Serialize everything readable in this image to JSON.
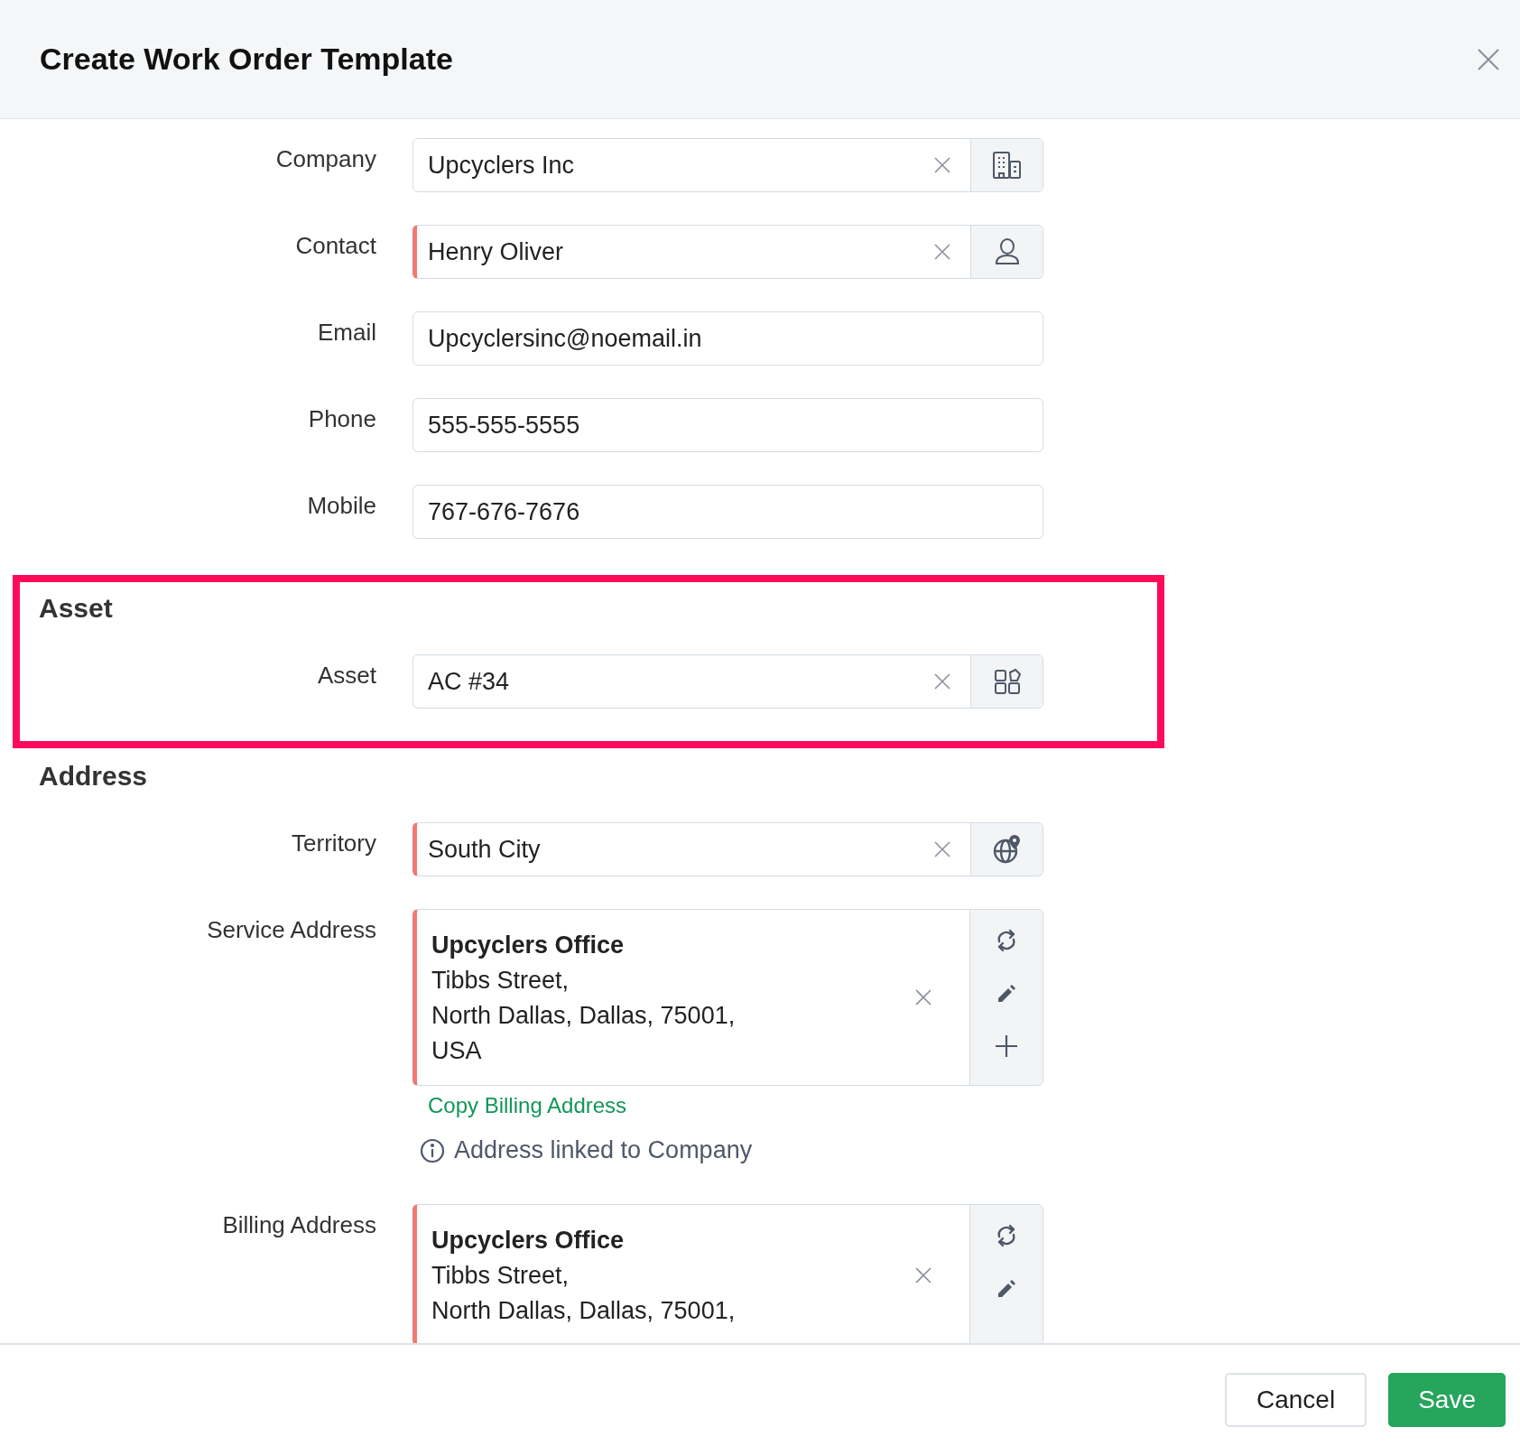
{
  "dialog": {
    "title": "Create Work Order Template"
  },
  "sections": [
    {
      "highlighted": false,
      "fields": [
        {
          "kind": "company",
          "label": "Company",
          "value": "Upcyclers Inc",
          "required": false
        },
        {
          "kind": "contact",
          "label": "Contact",
          "value": "Henry Oliver",
          "required": true
        },
        {
          "kind": "text",
          "label": "Email",
          "value": "Upcyclersinc@noemail.in",
          "required": false
        },
        {
          "kind": "text",
          "label": "Phone",
          "value": "555-555-5555",
          "required": false
        },
        {
          "kind": "text",
          "label": "Mobile",
          "value": "767-676-7676",
          "required": false
        }
      ]
    },
    {
      "heading": "Asset",
      "highlighted": true,
      "fields": [
        {
          "kind": "asset",
          "label": "Asset",
          "value": "AC #34",
          "required": false
        }
      ]
    },
    {
      "heading": "Address",
      "highlighted": false,
      "fields": [
        {
          "kind": "territory",
          "label": "Territory",
          "value": "South City",
          "required": true
        },
        {
          "kind": "address",
          "label": "Service Address",
          "title": "Upcyclers Office",
          "lines": [
            "Tibbs Street,",
            "North Dallas, Dallas, 75001,",
            "USA"
          ],
          "required": true,
          "actions": [
            {
              "kind": "refresh"
            },
            {
              "kind": "edit"
            },
            {
              "kind": "add"
            }
          ],
          "link": "Copy Billing Address",
          "note": "Address linked to Company"
        },
        {
          "kind": "address",
          "label": "Billing Address",
          "title": "Upcyclers Office",
          "lines": [
            "Tibbs Street,",
            "North Dallas, Dallas, 75001,"
          ],
          "required": true,
          "actions": [
            {
              "kind": "refresh"
            },
            {
              "kind": "edit"
            }
          ]
        }
      ]
    }
  ],
  "footer": {
    "buttons": [
      {
        "label": "Cancel",
        "kind": "secondary"
      },
      {
        "label": "Save",
        "kind": "primary"
      }
    ]
  }
}
